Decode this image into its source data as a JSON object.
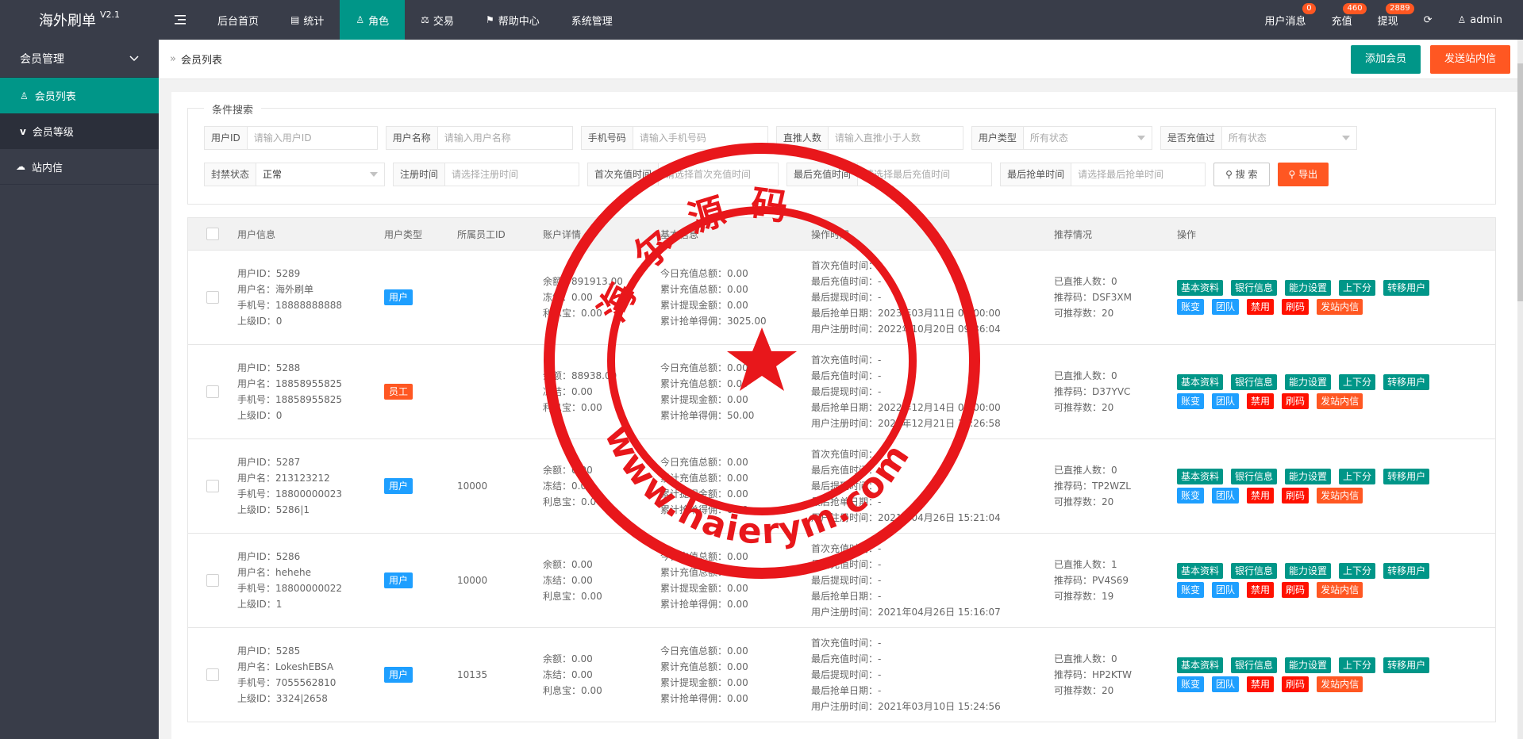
{
  "brand": {
    "name": "海外刷单",
    "version": "V2.1"
  },
  "topnav": {
    "items": [
      {
        "label": "后台首页",
        "icon": ""
      },
      {
        "label": "统计",
        "icon": "database-icon"
      },
      {
        "label": "角色",
        "icon": "user-icon",
        "active": true
      },
      {
        "label": "交易",
        "icon": "balance-icon"
      },
      {
        "label": "帮助中心",
        "icon": "flag-icon"
      },
      {
        "label": "系统管理",
        "icon": ""
      }
    ],
    "menu_toggle_icon": "menu-toggle-icon",
    "right": [
      {
        "label": "用户消息",
        "badge": "0"
      },
      {
        "label": "充值",
        "badge": "460"
      },
      {
        "label": "提现",
        "badge": "2889"
      }
    ],
    "refresh_icon": "refresh-icon",
    "user": "admin"
  },
  "sidebar": {
    "group": "会员管理",
    "items": [
      {
        "label": "会员列表",
        "icon": "user-icon",
        "active": true
      },
      {
        "label": "会员等级",
        "icon": "vimeo-icon"
      }
    ],
    "extra": {
      "label": "站内信",
      "icon": "cloud-icon"
    }
  },
  "breadcrumb": {
    "current": "会员列表"
  },
  "header_buttons": {
    "add": "添加会员",
    "send": "发送站内信"
  },
  "search": {
    "legend": "条件搜索",
    "row1": [
      {
        "label": "用户ID",
        "placeholder": "请输入用户ID",
        "width": 0
      },
      {
        "label": "用户名称",
        "placeholder": "请输入用户名称"
      },
      {
        "label": "手机号码",
        "placeholder": "请输入手机号码"
      },
      {
        "label": "直推人数",
        "placeholder": "请输入直推小于人数"
      },
      {
        "label": "用户类型",
        "placeholder": "所有状态"
      },
      {
        "label": "是否充值过",
        "placeholder": "所有状态"
      }
    ],
    "row2": [
      {
        "label": "封禁状态",
        "value": "正常"
      },
      {
        "label": "注册时间",
        "placeholder": "请选择注册时间"
      },
      {
        "label": "首次充值时间",
        "placeholder": "请选择首次充值时间"
      },
      {
        "label": "最后充值时间",
        "placeholder": "请选择最后充值时间"
      },
      {
        "label": "最后抢单时间",
        "placeholder": "请选择最后抢单时间"
      }
    ],
    "search_btn": "搜 索",
    "export_btn": "导出"
  },
  "table": {
    "columns": [
      "用户信息",
      "用户类型",
      "所属员工ID",
      "账户详情",
      "基本信息",
      "操作时间",
      "推荐情况",
      "操作"
    ],
    "rows": [
      {
        "info": [
          "用户ID：5289",
          "用户名：海外刷单",
          "手机号：18888888888",
          "上级ID：0"
        ],
        "type": "用户",
        "type_color": "#1e9fff",
        "staff": "",
        "account": [
          "余额：891913.00",
          "冻结：0.00",
          "利息宝：0.00"
        ],
        "basic": [
          "今日充值总额：0.00",
          "累计充值总额：0.00",
          "累计提现金额：0.00",
          "累计抢单得佣：3025.00"
        ],
        "times": [
          "首次充值时间：-",
          "最后充值时间：-",
          "最后提现时间：-",
          "最后抢单日期：2023年03月11日 00:00:00",
          "用户注册时间：2022年10月20日 09:36:04"
        ],
        "recommend": [
          "已直推人数：0",
          "推荐码：DSF3XM",
          "可推荐数：20"
        ]
      },
      {
        "info": [
          "用户ID：5288",
          "用户名：18858955825",
          "手机号：18858955825",
          "上级ID：0"
        ],
        "type": "员工",
        "type_color": "#ff5722",
        "staff": "",
        "account": [
          "余额：88938.00",
          "冻结：0.00",
          "利息宝：0.00"
        ],
        "basic": [
          "今日充值总额：0.00",
          "累计充值总额：0.00",
          "累计提现金额：0.00",
          "累计抢单得佣：50.00"
        ],
        "times": [
          "首次充值时间：-",
          "最后充值时间：-",
          "最后提现时间：-",
          "最后抢单日期：2022年12月14日 00:00:00",
          "用户注册时间：2021年12月21日 16:26:58"
        ],
        "recommend": [
          "已直推人数：0",
          "推荐码：D37YVC",
          "可推荐数：20"
        ]
      },
      {
        "info": [
          "用户ID：5287",
          "用户名：213123212",
          "手机号：18800000023",
          "上级ID：5286|1"
        ],
        "type": "用户",
        "type_color": "#1e9fff",
        "staff": "10000",
        "account": [
          "余额：0.00",
          "冻结：0.00",
          "利息宝：0.00"
        ],
        "basic": [
          "今日充值总额：0.00",
          "累计充值总额：0.00",
          "累计提现金额：0.00",
          "累计抢单得佣：0.00"
        ],
        "times": [
          "首次充值时间：-",
          "最后充值时间：-",
          "最后提现时间：-",
          "最后抢单日期：-",
          "用户注册时间：2021年04月26日 15:21:04"
        ],
        "recommend": [
          "已直推人数：0",
          "推荐码：TP2WZL",
          "可推荐数：20"
        ]
      },
      {
        "info": [
          "用户ID：5286",
          "用户名：hehehe",
          "手机号：18800000022",
          "上级ID：1"
        ],
        "type": "用户",
        "type_color": "#1e9fff",
        "staff": "10000",
        "account": [
          "余额：0.00",
          "冻结：0.00",
          "利息宝：0.00"
        ],
        "basic": [
          "今日充值总额：0.00",
          "累计充值总额：0.00",
          "累计提现金额：0.00",
          "累计抢单得佣：0.00"
        ],
        "times": [
          "首次充值时间：-",
          "最后充值时间：-",
          "最后提现时间：-",
          "最后抢单日期：-",
          "用户注册时间：2021年04月26日 15:16:07"
        ],
        "recommend": [
          "已直推人数：1",
          "推荐码：PV4S69",
          "可推荐数：19"
        ]
      },
      {
        "info": [
          "用户ID：5285",
          "用户名：LokeshEBSA",
          "手机号：7055562810",
          "上级ID：3324|2658"
        ],
        "type": "用户",
        "type_color": "#1e9fff",
        "staff": "10135",
        "account": [
          "余额：0.00",
          "冻结：0.00",
          "利息宝：0.00"
        ],
        "basic": [
          "今日充值总额：0.00",
          "累计充值总额：0.00",
          "累计提现金额：0.00",
          "累计抢单得佣：0.00"
        ],
        "times": [
          "首次充值时间：-",
          "最后充值时间：-",
          "最后提现时间：-",
          "最后抢单日期：-",
          "用户注册时间：2021年03月10日 15:24:56"
        ],
        "recommend": [
          "已直推人数：0",
          "推荐码：HP2KTW",
          "可推荐数：20"
        ]
      }
    ],
    "actions": [
      {
        "label": "基本资料",
        "style": "g"
      },
      {
        "label": "银行信息",
        "style": "g"
      },
      {
        "label": "能力设置",
        "style": "g"
      },
      {
        "label": "上下分",
        "style": "g"
      },
      {
        "label": "转移用户",
        "style": "g"
      },
      {
        "label": "账变",
        "style": "b"
      },
      {
        "label": "团队",
        "style": "b"
      },
      {
        "label": "禁用",
        "style": "r"
      },
      {
        "label": "刷码",
        "style": "r"
      },
      {
        "label": "发站内信",
        "style": "o"
      }
    ]
  },
  "watermark": {
    "text": "海尔源码",
    "url": "www.haierym.com"
  },
  "colors": {
    "primary": "#009688",
    "danger": "#ff5722",
    "header_bg": "#393d49",
    "stamp_red": "#e8171b"
  }
}
